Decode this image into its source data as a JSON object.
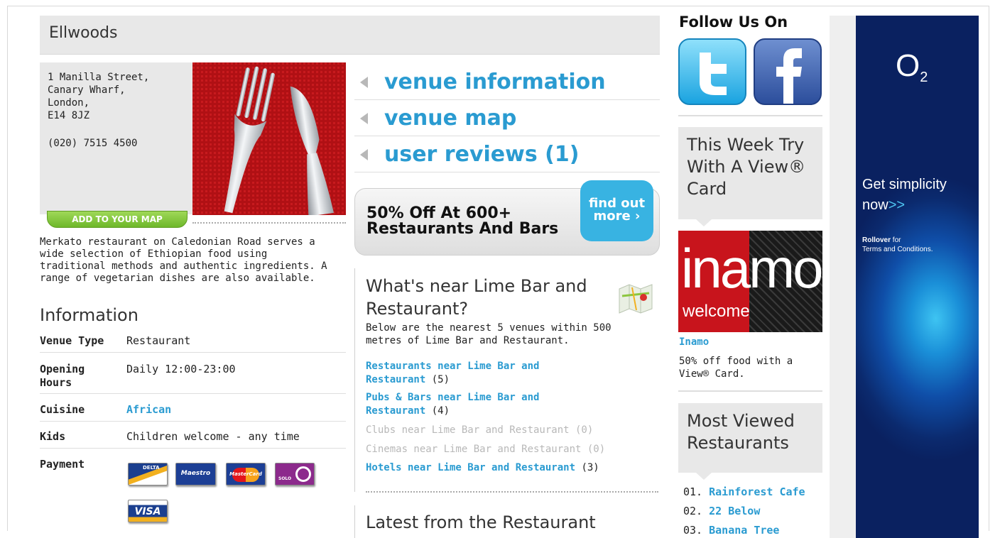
{
  "venue": {
    "title": "Ellwoods",
    "address": [
      "1 Manilla Street,",
      "Canary Wharf,",
      "London,",
      "E14 8JZ"
    ],
    "phone": "(020) 7515 4500",
    "add_map_label": "ADD TO YOUR MAP",
    "description": "Merkato restaurant on Caledonian Road serves a wide selection of Ethiopian food using traditional methods and authentic ingredients. A range of vegetarian dishes are also available."
  },
  "information": {
    "heading": "Information",
    "rows": [
      {
        "key": "Venue Type",
        "value": "Restaurant"
      },
      {
        "key": "Opening Hours",
        "value": "Daily 12:00-23:00"
      },
      {
        "key": "Cuisine",
        "value": "African"
      },
      {
        "key": "Kids",
        "value": "Children welcome - any time"
      },
      {
        "key": "Payment",
        "value": ""
      }
    ],
    "payment_cards": [
      "DELTA",
      "Maestro",
      "MasterCard",
      "SOLO",
      "VISA"
    ]
  },
  "nav": [
    {
      "label": "venue information"
    },
    {
      "label": "venue map"
    },
    {
      "label": "user reviews (1)"
    }
  ],
  "promo": {
    "text_line1": "50% Off At 600+",
    "text_line2": "Restaurants And Bars",
    "button_line1": "find out",
    "button_line2": "more ›"
  },
  "nearby": {
    "title": "What's near Lime Bar and Restaurant?",
    "intro": "Below are the nearest 5 venues within 500 metres of Lime Bar and Restaurant.",
    "items": [
      {
        "line1": "Restaurants near Lime Bar and",
        "line2": "Restaurant",
        "count": "(5)",
        "active": true
      },
      {
        "line1": "Pubs & Bars near Lime Bar and",
        "line2": "Restaurant",
        "count": "(4)",
        "active": true
      },
      {
        "line1": "Clubs near Lime Bar and Restaurant (0)",
        "active": false
      },
      {
        "line1": "Cinemas near Lime Bar and Restaurant (0)",
        "active": false
      },
      {
        "line1": "Hotels near Lime Bar and Restaurant",
        "count": "(3)",
        "active": true
      }
    ],
    "latest_heading": "Latest from the Restaurant"
  },
  "sidebar": {
    "follow_heading": "Follow Us On",
    "this_week_heading": "This Week Try With A View® Card",
    "feature_image_text": "inamo",
    "feature_image_sub": "welcome",
    "feature_name": "Inamo",
    "feature_desc": "50% off food with a View® Card.",
    "most_viewed_heading": "Most Viewed Restaurants",
    "most_viewed": [
      {
        "num": "01.",
        "name": "Rainforest Cafe"
      },
      {
        "num": "02.",
        "name": "22 Below"
      },
      {
        "num": "03.",
        "name": "Banana Tree"
      }
    ]
  },
  "ad": {
    "brand": "O",
    "brand_sub": "2",
    "headline_1": "Get simplicity",
    "headline_2": "now",
    "headline_arrow": ">>",
    "small_bold": "Rollover",
    "small_1": " for",
    "small_2": "Terms and Conditions."
  },
  "colors": {
    "link": "#2a9bd1",
    "panel_gray": "#e8e8e8",
    "add_map_green": "#6eb82a"
  }
}
